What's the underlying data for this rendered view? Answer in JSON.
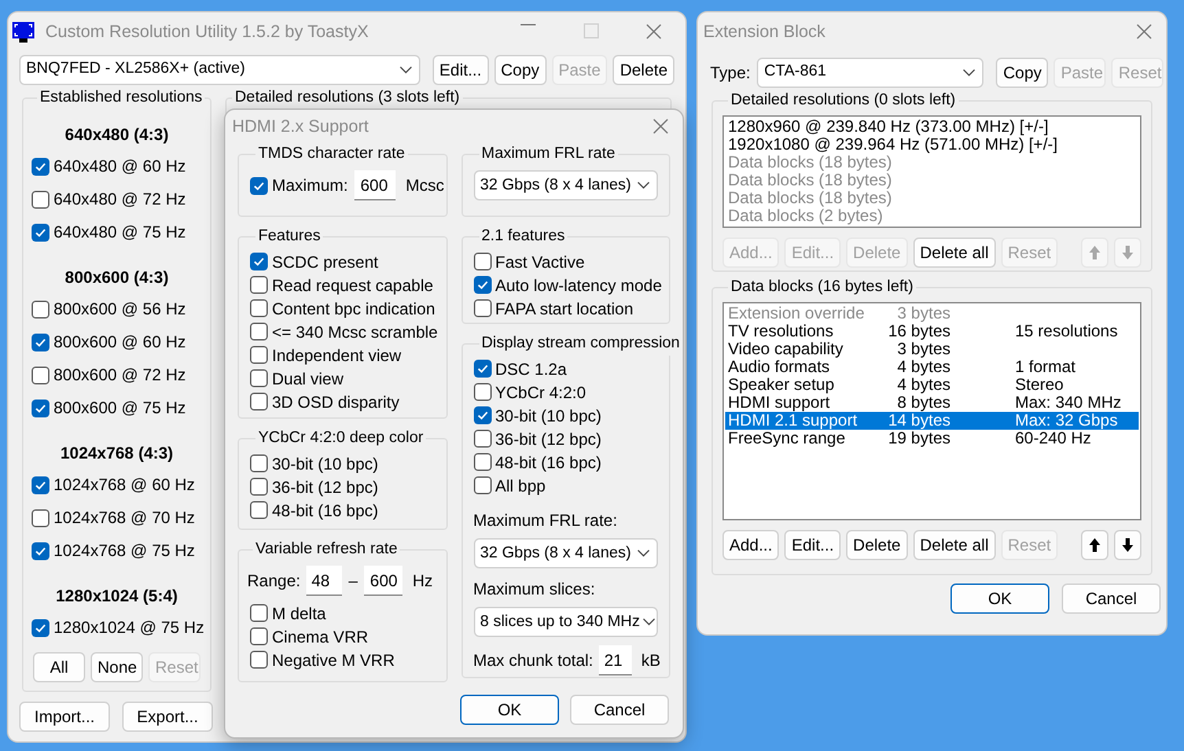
{
  "main_window": {
    "title": "Custom Resolution Utility 1.5.2 by ToastyX",
    "device": "BNQ7FED - XL2586X+ (active)",
    "device_buttons": [
      {
        "label": "Edit...",
        "disabled": false
      },
      {
        "label": "Copy",
        "disabled": false
      },
      {
        "label": "Paste",
        "disabled": true
      },
      {
        "label": "Delete",
        "disabled": false
      }
    ],
    "established": {
      "title": "Established resolutions",
      "groups": [
        {
          "heading": "640x480 (4:3)",
          "items": [
            {
              "label": "640x480 @ 60 Hz",
              "checked": true
            },
            {
              "label": "640x480 @ 72 Hz",
              "checked": false
            },
            {
              "label": "640x480 @ 75 Hz",
              "checked": true
            }
          ]
        },
        {
          "heading": "800x600 (4:3)",
          "items": [
            {
              "label": "800x600 @ 56 Hz",
              "checked": false
            },
            {
              "label": "800x600 @ 60 Hz",
              "checked": true
            },
            {
              "label": "800x600 @ 72 Hz",
              "checked": false
            },
            {
              "label": "800x600 @ 75 Hz",
              "checked": true
            }
          ]
        },
        {
          "heading": "1024x768 (4:3)",
          "items": [
            {
              "label": "1024x768 @ 60 Hz",
              "checked": true
            },
            {
              "label": "1024x768 @ 70 Hz",
              "checked": false
            },
            {
              "label": "1024x768 @ 75 Hz",
              "checked": true
            }
          ]
        },
        {
          "heading": "1280x1024 (5:4)",
          "items": [
            {
              "label": "1280x1024 @ 75 Hz",
              "checked": true
            }
          ]
        }
      ],
      "buttons": [
        {
          "label": "All",
          "disabled": false
        },
        {
          "label": "None",
          "disabled": false
        },
        {
          "label": "Reset",
          "disabled": true
        }
      ]
    },
    "detailed": {
      "title": "Detailed resolutions (3 slots left)"
    },
    "bottom_buttons": [
      {
        "label": "Import...",
        "disabled": false
      },
      {
        "label": "Export...",
        "disabled": false
      }
    ]
  },
  "hdmi_dialog": {
    "title": "HDMI 2.x Support",
    "tmds": {
      "title": "TMDS character rate",
      "label": "Maximum:",
      "checked": true,
      "value": "600",
      "unit": "Mcsc"
    },
    "features": {
      "title": "Features",
      "items": [
        {
          "label": "SCDC present",
          "checked": true
        },
        {
          "label": "Read request capable",
          "checked": false
        },
        {
          "label": "Content bpc indication",
          "checked": false
        },
        {
          "label": "<= 340 Mcsc scramble",
          "checked": false
        },
        {
          "label": "Independent view",
          "checked": false
        },
        {
          "label": "Dual view",
          "checked": false
        },
        {
          "label": "3D OSD disparity",
          "checked": false
        }
      ]
    },
    "deep_color": {
      "title": "YCbCr 4:2:0 deep color",
      "items": [
        {
          "label": "30-bit (10 bpc)",
          "checked": false
        },
        {
          "label": "36-bit (12 bpc)",
          "checked": false
        },
        {
          "label": "48-bit (16 bpc)",
          "checked": false
        }
      ]
    },
    "vrr": {
      "title": "Variable refresh rate",
      "range_label": "Range:",
      "min": "48",
      "separator": "–",
      "max": "600",
      "unit": "Hz",
      "items": [
        {
          "label": "M delta",
          "checked": false
        },
        {
          "label": "Cinema VRR",
          "checked": false
        },
        {
          "label": "Negative M VRR",
          "checked": false
        }
      ]
    },
    "frl": {
      "title": "Maximum FRL rate",
      "value": "32 Gbps (8 x 4 lanes)"
    },
    "features_21": {
      "title": "2.1 features",
      "items": [
        {
          "label": "Fast Vactive",
          "checked": false
        },
        {
          "label": "Auto low-latency mode",
          "checked": true
        },
        {
          "label": "FAPA start location",
          "checked": false
        }
      ]
    },
    "dsc": {
      "title": "Display stream compression",
      "items": [
        {
          "label": "DSC 1.2a",
          "checked": true
        },
        {
          "label": "YCbCr 4:2:0",
          "checked": false
        },
        {
          "label": "30-bit (10 bpc)",
          "checked": true
        },
        {
          "label": "36-bit (12 bpc)",
          "checked": false
        },
        {
          "label": "48-bit (16 bpc)",
          "checked": false
        },
        {
          "label": "All bpp",
          "checked": false
        }
      ],
      "frl_label": "Maximum FRL rate:",
      "frl_value": "32 Gbps (8 x 4 lanes)",
      "slices_label": "Maximum slices:",
      "slices_value": "8 slices up to 340 MHz",
      "chunk_label": "Max chunk total:",
      "chunk_value": "21",
      "chunk_unit": "kB"
    },
    "buttons": [
      {
        "label": "OK",
        "default": true
      },
      {
        "label": "Cancel",
        "default": false
      }
    ]
  },
  "extension_block": {
    "title": "Extension Block",
    "type_label": "Type:",
    "type_value": "CTA-861",
    "type_buttons": [
      {
        "label": "Copy",
        "disabled": false
      },
      {
        "label": "Paste",
        "disabled": true
      },
      {
        "label": "Reset",
        "disabled": true
      }
    ],
    "detailed": {
      "title": "Detailed resolutions (0 slots left)",
      "rows": [
        {
          "text": "1280x960 @ 239.840 Hz (373.00 MHz) [+/-]",
          "disabled": false
        },
        {
          "text": "1920x1080 @ 239.964 Hz (571.00 MHz) [+/-]",
          "disabled": false
        },
        {
          "text": "Data blocks (18 bytes)",
          "disabled": true
        },
        {
          "text": "Data blocks (18 bytes)",
          "disabled": true
        },
        {
          "text": "Data blocks (18 bytes)",
          "disabled": true
        },
        {
          "text": "Data blocks (2 bytes)",
          "disabled": true
        }
      ],
      "buttons": [
        {
          "label": "Add...",
          "disabled": true
        },
        {
          "label": "Edit...",
          "disabled": true
        },
        {
          "label": "Delete",
          "disabled": true
        },
        {
          "label": "Delete all",
          "disabled": false
        },
        {
          "label": "Reset",
          "disabled": true
        }
      ],
      "arrows": [
        {
          "kind": "up",
          "disabled": true
        },
        {
          "kind": "down",
          "disabled": true
        }
      ]
    },
    "data_blocks": {
      "title": "Data blocks (16 bytes left)",
      "rows": [
        {
          "name": "Extension override",
          "size": "3 bytes",
          "info": "",
          "disabled": true,
          "selected": false
        },
        {
          "name": "TV resolutions",
          "size": "16 bytes",
          "info": "15 resolutions",
          "disabled": false,
          "selected": false
        },
        {
          "name": "Video capability",
          "size": "3 bytes",
          "info": "",
          "disabled": false,
          "selected": false
        },
        {
          "name": "Audio formats",
          "size": "4 bytes",
          "info": "1 format",
          "disabled": false,
          "selected": false
        },
        {
          "name": "Speaker setup",
          "size": "4 bytes",
          "info": "Stereo",
          "disabled": false,
          "selected": false
        },
        {
          "name": "HDMI support",
          "size": "8 bytes",
          "info": "Max: 340 MHz",
          "disabled": false,
          "selected": false
        },
        {
          "name": "HDMI 2.1 support",
          "size": "14 bytes",
          "info": "Max: 32 Gbps",
          "disabled": false,
          "selected": true
        },
        {
          "name": "FreeSync range",
          "size": "19 bytes",
          "info": "60-240 Hz",
          "disabled": false,
          "selected": false
        }
      ],
      "buttons": [
        {
          "label": "Add...",
          "disabled": false
        },
        {
          "label": "Edit...",
          "disabled": false
        },
        {
          "label": "Delete",
          "disabled": false
        },
        {
          "label": "Delete all",
          "disabled": false
        },
        {
          "label": "Reset",
          "disabled": true
        }
      ],
      "arrows": [
        {
          "kind": "up",
          "disabled": false
        },
        {
          "kind": "down",
          "disabled": false
        }
      ]
    },
    "buttons": [
      {
        "label": "OK",
        "default": true
      },
      {
        "label": "Cancel",
        "default": false
      }
    ]
  }
}
